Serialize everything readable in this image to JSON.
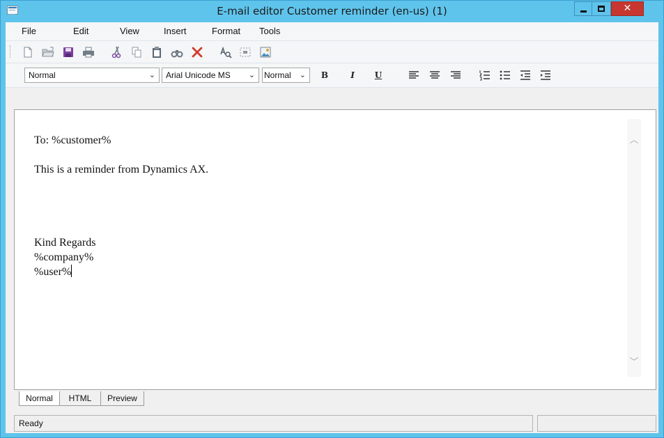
{
  "window": {
    "title": "E-mail editor Customer reminder (en-us) (1)",
    "controls": {
      "minimize": "minimize-icon",
      "maximize": "maximize-icon",
      "close": "✕"
    }
  },
  "menu": [
    "File",
    "Edit",
    "View",
    "Insert",
    "Format",
    "Tools"
  ],
  "toolbar": {
    "buttons": [
      "new-document-icon",
      "open-folder-icon",
      "save-icon",
      "print-icon",
      "cut-icon",
      "copy-icon",
      "paste-icon",
      "find-icon",
      "delete-icon",
      "spell-check-icon",
      "link-icon",
      "image-icon"
    ]
  },
  "format": {
    "style_value": "Normal",
    "font_value": "Arial Unicode MS",
    "size_value": "Normal",
    "bold": "B",
    "italic": "I",
    "underline": "U",
    "buttons": [
      "align-left-icon",
      "align-center-icon",
      "align-right-icon",
      "numbered-list-icon",
      "bulleted-list-icon",
      "decrease-indent-icon",
      "increase-indent-icon"
    ]
  },
  "editor": {
    "lines": [
      "To: %customer%",
      "",
      "This is a reminder from Dynamics AX.",
      "",
      "",
      "",
      "",
      "Kind Regards",
      "%company%",
      "%user%"
    ]
  },
  "tabs": [
    "Normal",
    "HTML",
    "Preview"
  ],
  "active_tab": "Normal",
  "status": {
    "text": "Ready",
    "secondary": ""
  },
  "colors": {
    "title_bar": "#5fc4ec",
    "close_button": "#c7372f",
    "save_icon": "#7b3f9e",
    "delete_icon": "#d13b2a"
  }
}
